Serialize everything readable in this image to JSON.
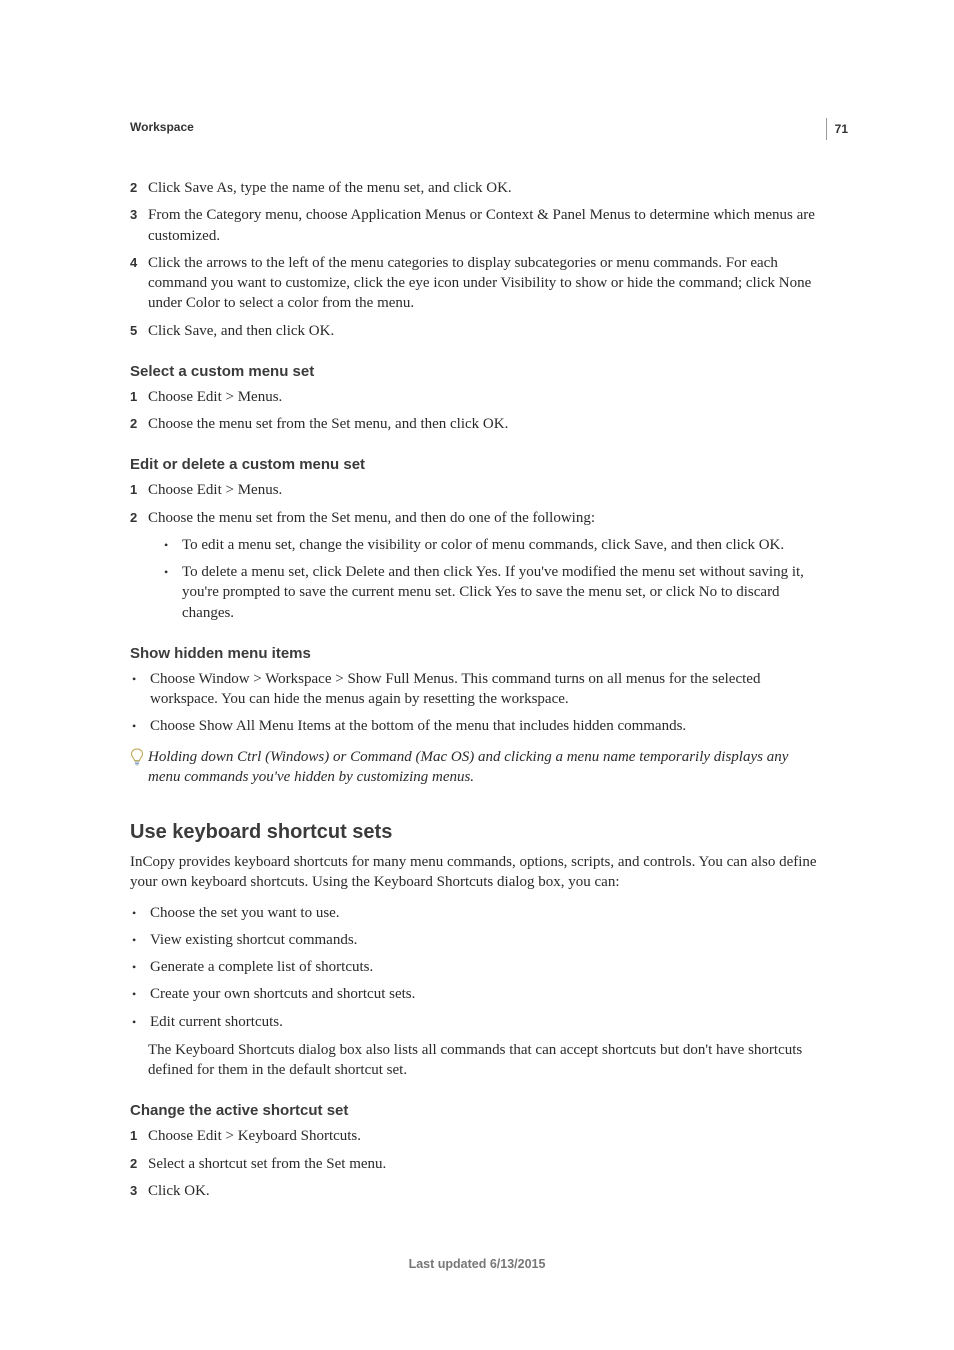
{
  "header": {
    "running_head": "Workspace",
    "page_number": "71"
  },
  "top_steps": [
    {
      "n": "2",
      "t": "Click Save As, type the name of the menu set, and click OK."
    },
    {
      "n": "3",
      "t": "From the Category menu, choose Application Menus or Context & Panel Menus to determine which menus are customized."
    },
    {
      "n": "4",
      "t": "Click the arrows to the left of the menu categories to display subcategories or menu commands. For each command you want to customize, click the eye icon under Visibility to show or hide the command; click None under Color to select a color from the menu."
    },
    {
      "n": "5",
      "t": "Click Save, and then click OK."
    }
  ],
  "select_set": {
    "heading": "Select a custom menu set",
    "steps": [
      {
        "n": "1",
        "t": "Choose Edit > Menus."
      },
      {
        "n": "2",
        "t": "Choose the menu set from the Set menu, and then click OK."
      }
    ]
  },
  "edit_delete": {
    "heading": "Edit or delete a custom menu set",
    "steps": [
      {
        "n": "1",
        "t": "Choose Edit > Menus."
      },
      {
        "n": "2",
        "t": "Choose the menu set from the Set menu, and then do one of the following:"
      }
    ],
    "subbullets": [
      "To edit a menu set, change the visibility or color of menu commands, click Save, and then click OK.",
      "To delete a menu set, click Delete and then click Yes. If you've modified the menu set without saving it, you're prompted to save the current menu set. Click Yes to save the menu set, or click No to discard changes."
    ]
  },
  "show_hidden": {
    "heading": "Show hidden menu items",
    "bullets": [
      "Choose Window > Workspace > Show Full Menus. This command turns on all menus for the selected workspace. You can hide the menus again by resetting the workspace.",
      "Choose Show All Menu Items at the bottom of the menu that includes hidden commands."
    ],
    "tip": "Holding down Ctrl (Windows) or Command (Mac OS) and clicking a menu name temporarily displays any menu commands you've hidden by customizing menus."
  },
  "kb_shortcuts": {
    "heading": "Use keyboard shortcut sets",
    "intro": "InCopy provides keyboard shortcuts for many menu commands, options, scripts, and controls. You can also define your own keyboard shortcuts. Using the Keyboard Shortcuts dialog box, you can:",
    "bullets": [
      "Choose the set you want to use.",
      "View existing shortcut commands.",
      "Generate a complete list of shortcuts.",
      "Create your own shortcuts and shortcut sets.",
      "Edit current shortcuts."
    ],
    "post_para": "The Keyboard Shortcuts dialog box also lists all commands that can accept shortcuts but don't have shortcuts defined for them in the default shortcut set."
  },
  "change_active": {
    "heading": "Change the active shortcut set",
    "steps": [
      {
        "n": "1",
        "t": "Choose Edit > Keyboard Shortcuts."
      },
      {
        "n": "2",
        "t": "Select a shortcut set from the Set menu."
      },
      {
        "n": "3",
        "t": "Click OK."
      }
    ]
  },
  "footer": {
    "text": "Last updated 6/13/2015"
  }
}
